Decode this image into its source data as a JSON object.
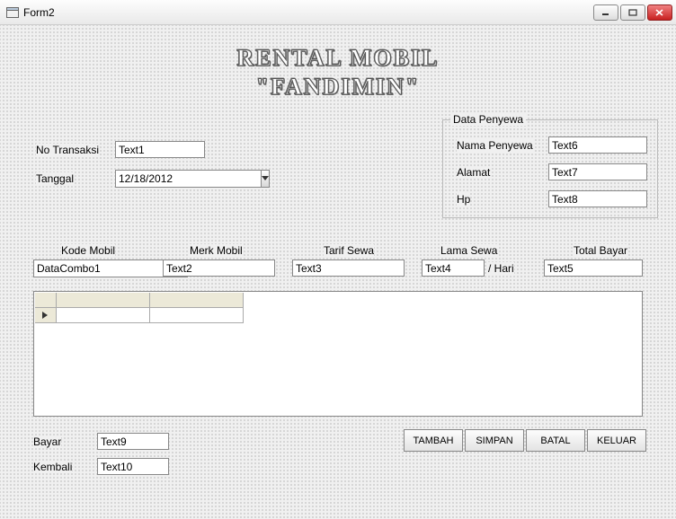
{
  "window": {
    "title": "Form2"
  },
  "heading": {
    "line1": "RENTAL MOBIL",
    "line2": "\"FANDIMIN\""
  },
  "labels": {
    "no_transaksi": "No Transaksi",
    "tanggal": "Tanggal",
    "data_penyewa": "Data Penyewa",
    "nama_penyewa": "Nama Penyewa",
    "alamat": "Alamat",
    "hp": "Hp",
    "kode_mobil": "Kode Mobil",
    "merk_mobil": "Merk Mobil",
    "tarif_sewa": "Tarif Sewa",
    "lama_sewa": "Lama Sewa",
    "per_hari": "/ Hari",
    "total_bayar": "Total Bayar",
    "bayar": "Bayar",
    "kembali": "Kembali"
  },
  "fields": {
    "no_transaksi": "Text1",
    "tanggal": "12/18/2012",
    "nama_penyewa": "Text6",
    "alamat": "Text7",
    "hp": "Text8",
    "kode_mobil": "DataCombo1",
    "merk_mobil": "Text2",
    "tarif_sewa": "Text3",
    "lama_sewa": "Text4",
    "total_bayar": "Text5",
    "bayar": "Text9",
    "kembali": "Text10"
  },
  "buttons": {
    "tambah": "TAMBAH",
    "simpan": "SIMPAN",
    "batal": "BATAL",
    "keluar": "KELUAR"
  }
}
